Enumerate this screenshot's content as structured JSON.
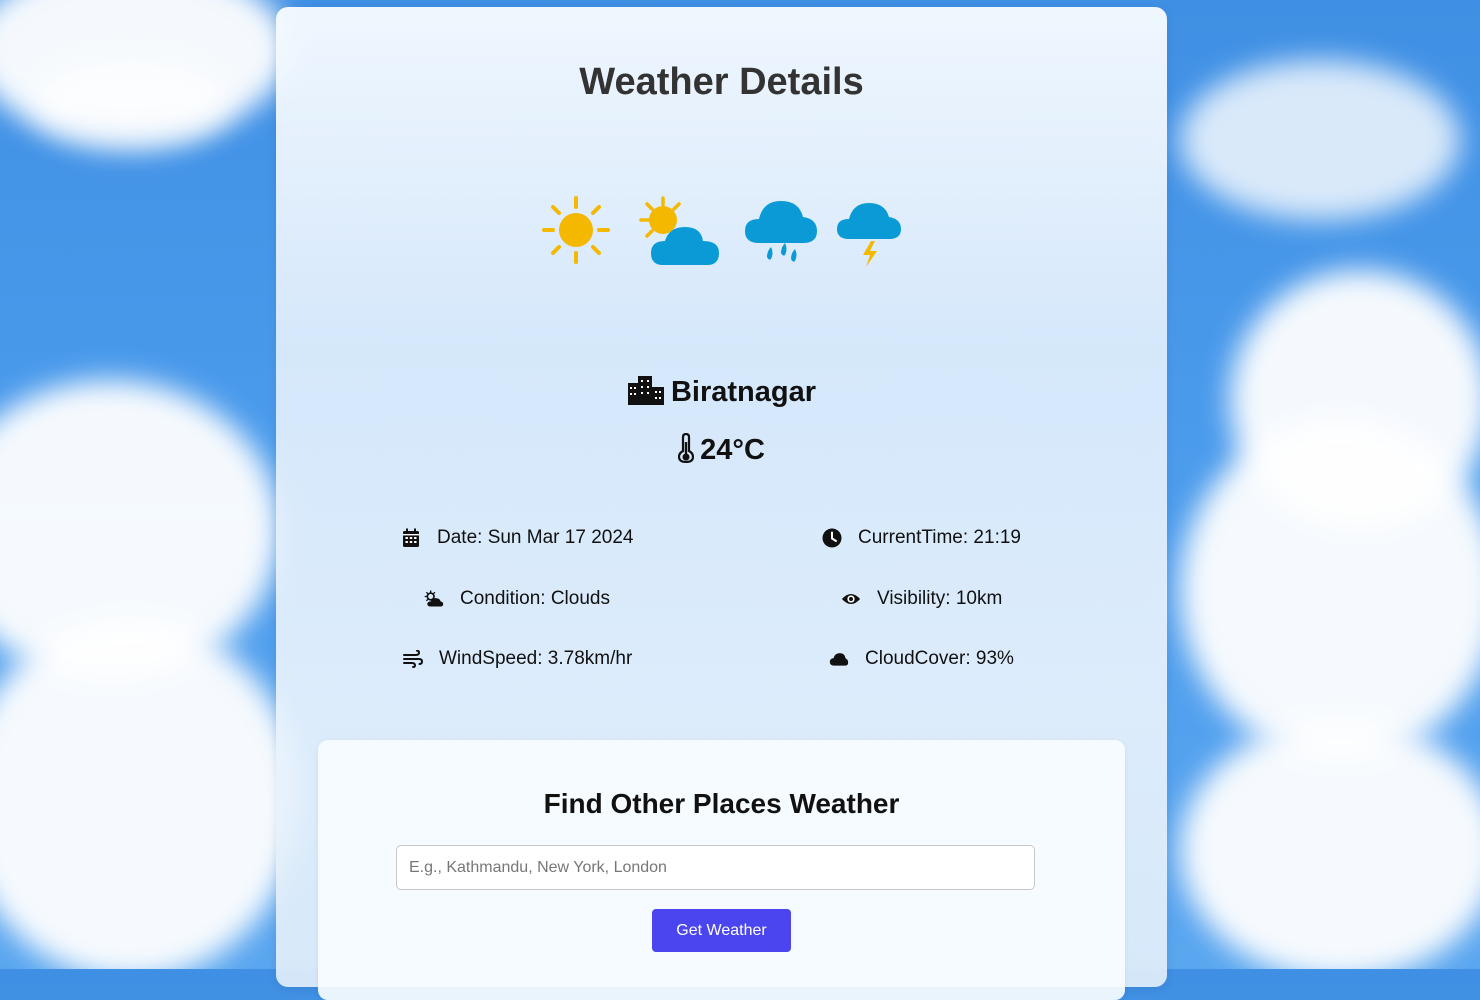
{
  "page": {
    "title": "Weather Details",
    "weather_icons": [
      "sun-icon",
      "partly-cloudy-icon",
      "rain-cloud-icon",
      "thunder-cloud-icon"
    ]
  },
  "current": {
    "city": "Biratnagar",
    "temperature": "24°C"
  },
  "details": {
    "date": "Date: Sun Mar 17 2024",
    "time": "CurrentTime: 21:19",
    "condition": "Condition: Clouds",
    "visibility": "Visibility: 10km",
    "wind": "WindSpeed: 3.78km/hr",
    "cloud_cover": "CloudCover: 93%"
  },
  "search": {
    "title": "Find Other Places Weather",
    "placeholder": "E.g., Kathmandu, New York, London",
    "value": "",
    "button_label": "Get Weather"
  },
  "colors": {
    "sky": "#4b9bec",
    "sun": "#f5b800",
    "cloud": "#0a9bd6",
    "button": "#4a45ef"
  }
}
